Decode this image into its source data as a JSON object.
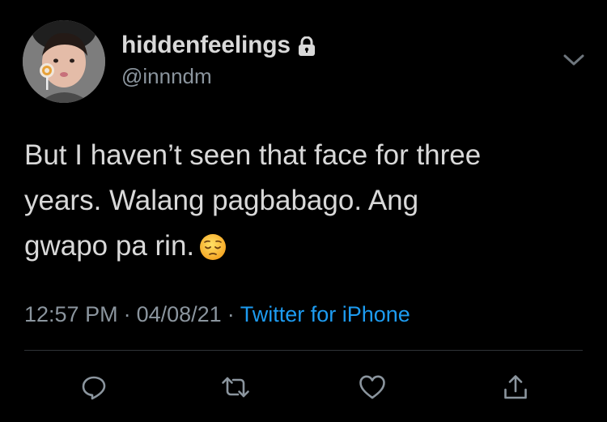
{
  "user": {
    "display_name": "hiddenfeelings",
    "handle": "@innndm",
    "protected_icon": "lock-icon"
  },
  "tweet": {
    "lines": [
      "But I haven’t seen that face for three",
      "years. Walang pagbabago. Ang",
      "gwapo pa rin."
    ],
    "emoji": "pensive-face"
  },
  "meta": {
    "time": "12:57 PM",
    "separator": "·",
    "date": "04/08/21",
    "source": "Twitter for iPhone"
  },
  "actions": {
    "reply_icon": "reply-icon",
    "retweet_icon": "retweet-icon",
    "like_icon": "heart-icon",
    "share_icon": "share-icon"
  },
  "colors": {
    "background": "#000000",
    "text": "#d9d9d9",
    "secondary": "#8b959e",
    "link": "#1d9bf0",
    "divider": "#2f3336"
  }
}
